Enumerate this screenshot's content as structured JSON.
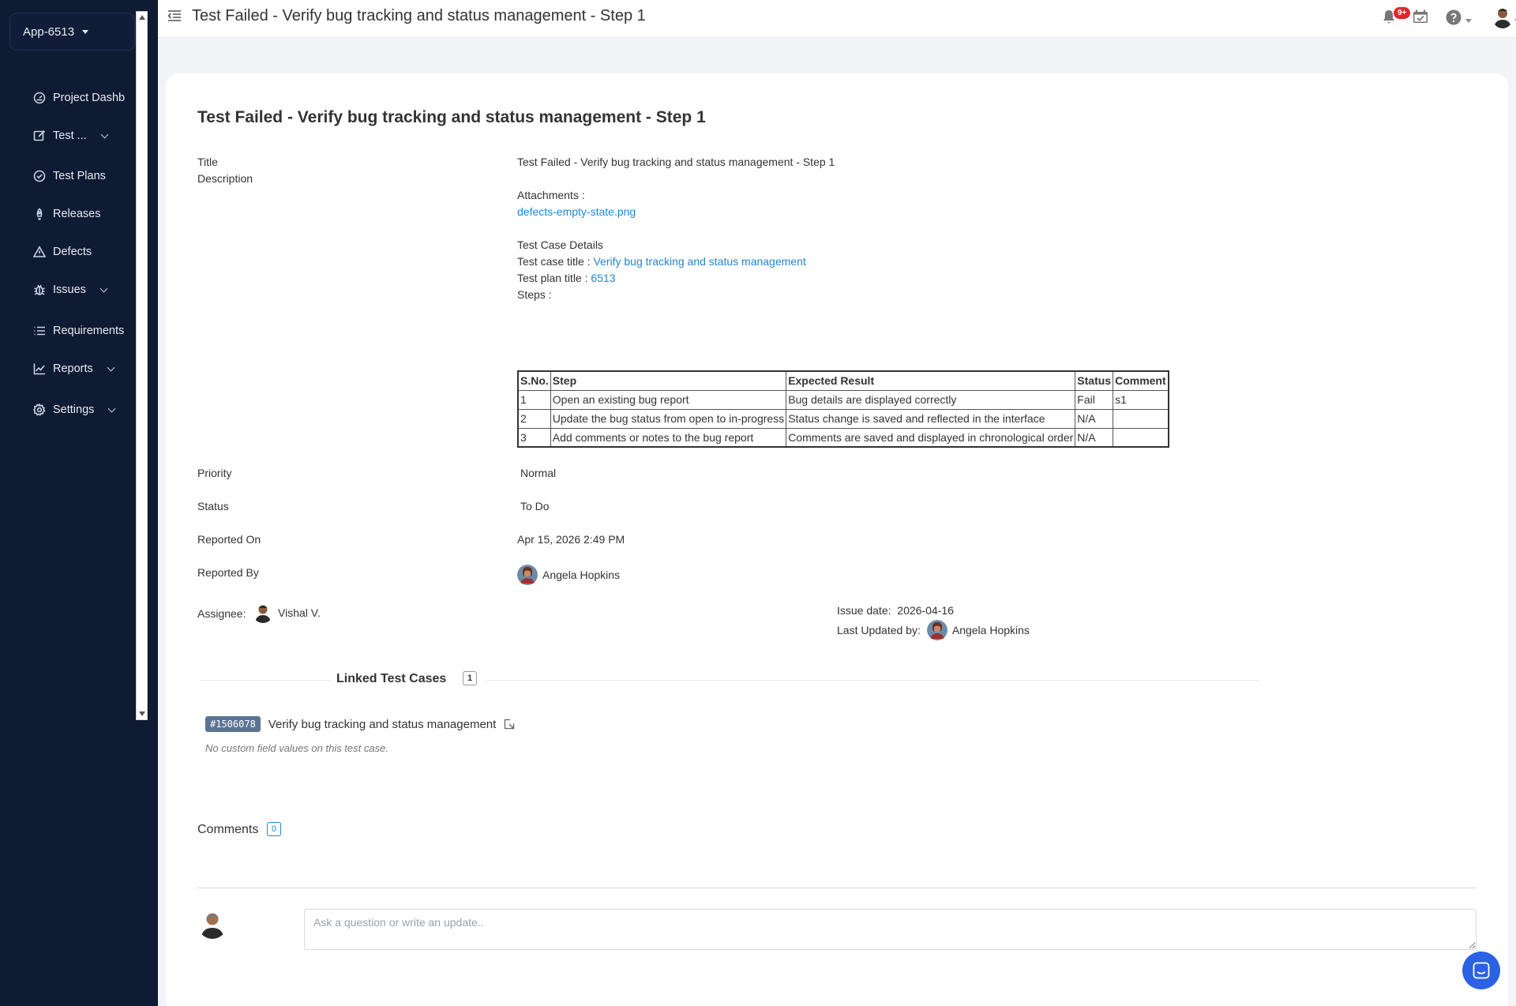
{
  "sidebar": {
    "app_name": "App-6513",
    "items": [
      {
        "label": "Project Dashb",
        "icon": "dashboard-icon"
      },
      {
        "label": "Test ...",
        "icon": "edit-icon",
        "has_submenu": true
      },
      {
        "label": "Test Plans",
        "icon": "check-circle-icon"
      },
      {
        "label": "Releases",
        "icon": "rocket-icon"
      },
      {
        "label": "Defects",
        "icon": "warning-icon"
      },
      {
        "label": "Issues",
        "icon": "bug-icon",
        "has_submenu": true
      },
      {
        "label": "Requirements",
        "icon": "list-icon"
      },
      {
        "label": "Reports",
        "icon": "chart-icon",
        "has_submenu": true
      },
      {
        "label": "Settings",
        "icon": "gear-icon",
        "has_submenu": true
      }
    ]
  },
  "header": {
    "title": "Test Failed - Verify bug tracking and status management - Step 1",
    "notification_badge": "9+",
    "icons": [
      "menu-collapse-icon",
      "bell-icon",
      "calendar-check-icon",
      "help-icon",
      "user-avatar"
    ]
  },
  "detail": {
    "heading": "Test Failed - Verify bug tracking and status management - Step 1",
    "title_label": "Title",
    "title_value": "Test Failed - Verify bug tracking and status management - Step 1",
    "description_label": "Description",
    "attachments_label": "Attachments :",
    "attachment_file": "defects-empty-state.png",
    "test_case_details_label": "Test Case Details",
    "test_case_title_label": "Test case title :",
    "test_case_title_value": "Verify bug tracking and status management",
    "test_plan_title_label": "Test plan title :",
    "test_plan_title_value": "6513",
    "steps_label": "Steps :",
    "steps_table": {
      "headers": [
        "S.No.",
        "Step",
        "Expected Result",
        "Status",
        "Comment"
      ],
      "rows": [
        [
          "1",
          "Open an existing bug report",
          "Bug details are displayed correctly",
          "Fail",
          "s1"
        ],
        [
          "2",
          "Update the bug status from open to in-progress",
          "Status change is saved and reflected in the interface",
          "N/A",
          ""
        ],
        [
          "3",
          "Add comments or notes to the bug report",
          "Comments are saved and displayed in chronological order",
          "N/A",
          ""
        ]
      ]
    },
    "priority_label": "Priority",
    "priority_value": "Normal",
    "status_label": "Status",
    "status_value": "To Do",
    "reported_on_label": "Reported On",
    "reported_on_value": "Apr 15, 2026 2:49 PM",
    "reported_by_label": "Reported By",
    "reported_by_value": "Angela Hopkins",
    "assignee_label": "Assignee:",
    "assignee_value": "Vishal V.",
    "issue_date_label": "Issue date:",
    "issue_date_value": "2026-04-16",
    "last_updated_label": "Last Updated by:",
    "last_updated_value": "Angela Hopkins"
  },
  "linked": {
    "title": "Linked Test Cases",
    "count": "1",
    "items": [
      {
        "id": "#1506078",
        "title": "Verify bug tracking and status management"
      }
    ],
    "note": "No custom field values on this test case."
  },
  "comments": {
    "title": "Comments",
    "count": "0",
    "placeholder": "Ask a question or write an update.."
  },
  "colors": {
    "sidebar_bg": "#0f1a33",
    "link": "#2186d9",
    "badge": "#e0262d",
    "chat_button": "#2b62e3",
    "tag_bg": "#5d7393"
  }
}
